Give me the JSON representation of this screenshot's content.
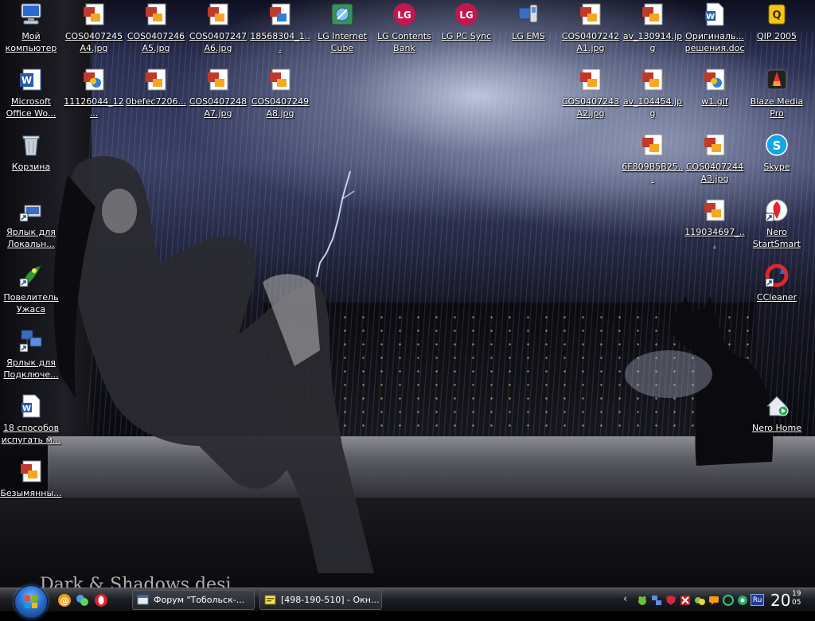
{
  "watermark": "Dark & Shadows desi",
  "desktop_icons": [
    {
      "id": "my-computer",
      "label": "Мой компьютер",
      "icon": "computer-icon"
    },
    {
      "id": "ms-office-word",
      "label": "Microsoft Office Wo...",
      "icon": "word-icon"
    },
    {
      "id": "recycle-bin",
      "label": "Корзина",
      "icon": "recycle-bin-icon"
    },
    {
      "id": "local-shortcut",
      "label": "Ярлык для Локальн...",
      "icon": "shortcut-icon"
    },
    {
      "id": "povelitel",
      "label": "Повелитель Ужаса",
      "icon": "game-icon"
    },
    {
      "id": "connect-shortcut",
      "label": "Ярлык для Подключе...",
      "icon": "network-icon"
    },
    {
      "id": "doc-18",
      "label": "18 способов испугать м...",
      "icon": "word-doc-icon"
    },
    {
      "id": "untitled",
      "label": "Безымянны...",
      "icon": "image-file-icon"
    },
    {
      "id": "cos245",
      "label": "COS0407245A4.jpg",
      "icon": "image-file-icon"
    },
    {
      "id": "cos246",
      "label": "COS0407246A5.jpg",
      "icon": "image-file-icon"
    },
    {
      "id": "cos247",
      "label": "COS0407247A6.jpg",
      "icon": "image-file-icon"
    },
    {
      "id": "f18568304",
      "label": "18568304_1...",
      "icon": "image-file-icon"
    },
    {
      "id": "lg-internet-cube",
      "label": "LG Internet Cube",
      "icon": "lg-cube-icon"
    },
    {
      "id": "lg-contents-bank",
      "label": "LG Contents Bank",
      "icon": "lg-icon"
    },
    {
      "id": "lg-pc-sync",
      "label": "LG PC Sync",
      "icon": "lg-icon"
    },
    {
      "id": "lg-ems",
      "label": "LG EMS",
      "icon": "lg-ems-icon"
    },
    {
      "id": "cos242",
      "label": "COS0407242A1.jpg",
      "icon": "image-file-icon"
    },
    {
      "id": "av130914",
      "label": "av_130914.jpg",
      "icon": "image-file-icon"
    },
    {
      "id": "original-doc",
      "label": "Оригиналь... решения.doc",
      "icon": "word-doc-icon"
    },
    {
      "id": "qip2005",
      "label": "QIP 2005",
      "icon": "qip-icon"
    },
    {
      "id": "f11126044",
      "label": "11126044_12...",
      "icon": "gif-file-icon"
    },
    {
      "id": "f0befec",
      "label": "0befec7206...",
      "icon": "gif-file-icon"
    },
    {
      "id": "cos248",
      "label": "COS0407248A7.jpg",
      "icon": "image-file-icon"
    },
    {
      "id": "cos249",
      "label": "COS0407249A8.jpg",
      "icon": "image-file-icon"
    },
    {
      "id": "cos243",
      "label": "COS0407243A2.jpg",
      "icon": "image-file-icon"
    },
    {
      "id": "av104454",
      "label": "av_104454.jpg",
      "icon": "image-file-icon"
    },
    {
      "id": "w1gif",
      "label": "w1.gif",
      "icon": "gif-file-icon"
    },
    {
      "id": "blaze",
      "label": "Blaze Media Pro",
      "icon": "media-player-icon"
    },
    {
      "id": "f6f809",
      "label": "6F809B5B25...",
      "icon": "image-file-icon"
    },
    {
      "id": "cos244",
      "label": "COS0407244A3.jpg",
      "icon": "image-file-icon"
    },
    {
      "id": "skype",
      "label": "Skype",
      "icon": "skype-icon"
    },
    {
      "id": "f119034697",
      "label": "119034697_...",
      "icon": "image-file-icon"
    },
    {
      "id": "nero-startsmart",
      "label": "Nero StartSmart",
      "icon": "nero-icon"
    },
    {
      "id": "ccleaner",
      "label": "CCleaner",
      "icon": "ccleaner-icon"
    },
    {
      "id": "nero-home",
      "label": "Nero Home",
      "icon": "nero-home-icon"
    }
  ],
  "taskbar": {
    "start_icon": "windows-orb-icon",
    "quick_launch": [
      "mail-at-icon",
      "messenger-icon",
      "opera-icon"
    ],
    "tasks": [
      {
        "label": "Форум \"Тобольск-...",
        "icon": "browser-icon"
      },
      {
        "label": "[498-190-510] - Окн...",
        "icon": "chat-window-icon"
      }
    ],
    "tray_icons": [
      "frog-icon",
      "network-icon",
      "shield-icon",
      "antivirus-icon",
      "devices-icon",
      "chat-icon",
      "gamepad-icon",
      "icq-icon",
      "status-icon"
    ],
    "language": "Ru",
    "clock_hour": "20",
    "clock_minute": "19",
    "clock_second": "05"
  },
  "colors": {
    "label_text": "#ffffff",
    "taskbar": "#1e2026",
    "lang_badge": "#1b3c9a"
  }
}
